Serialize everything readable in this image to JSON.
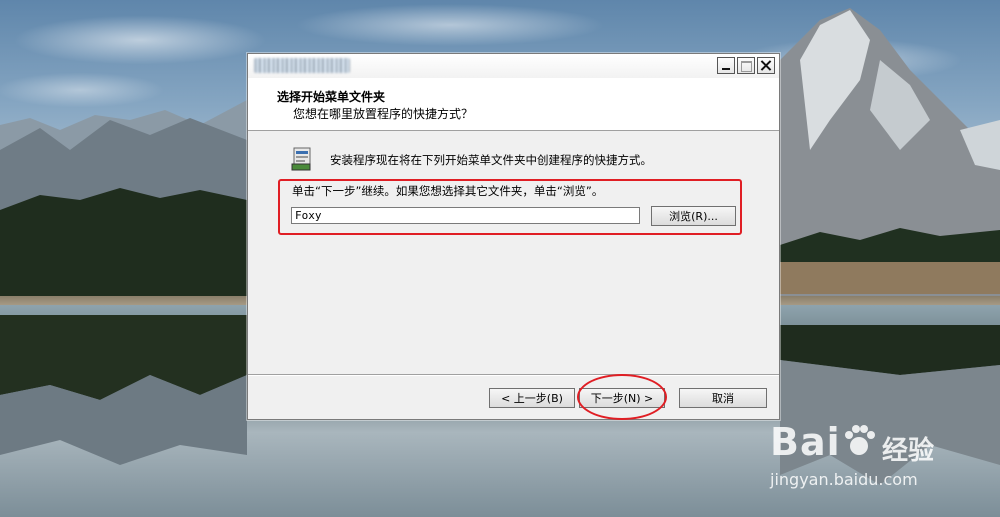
{
  "window": {
    "header_title": "选择开始菜单文件夹",
    "header_subtitle": "您想在哪里放置程序的快捷方式？",
    "description": "安装程序现在将在下列开始菜单文件夹中创建程序的快捷方式。",
    "instruction": "单击“下一步”继续。如果您想选择其它文件夹，单击“浏览”。",
    "folder_value": "Foxy",
    "browse_label": "浏览(R)...",
    "back_label": "< 上一步(B)",
    "next_label": "下一步(N) >",
    "cancel_label": "取消"
  },
  "watermark": {
    "brand": "Bai",
    "brand_cn": "经验",
    "url": "jingyan.baidu.com"
  },
  "colors": {
    "annotation_red": "#e01e24",
    "dialog_bg": "#f0f0f0",
    "header_bg": "#ffffff"
  },
  "icons": [
    "setup-program-icon",
    "minimize-icon",
    "maximize-icon",
    "close-icon",
    "baidu-paw-icon"
  ]
}
